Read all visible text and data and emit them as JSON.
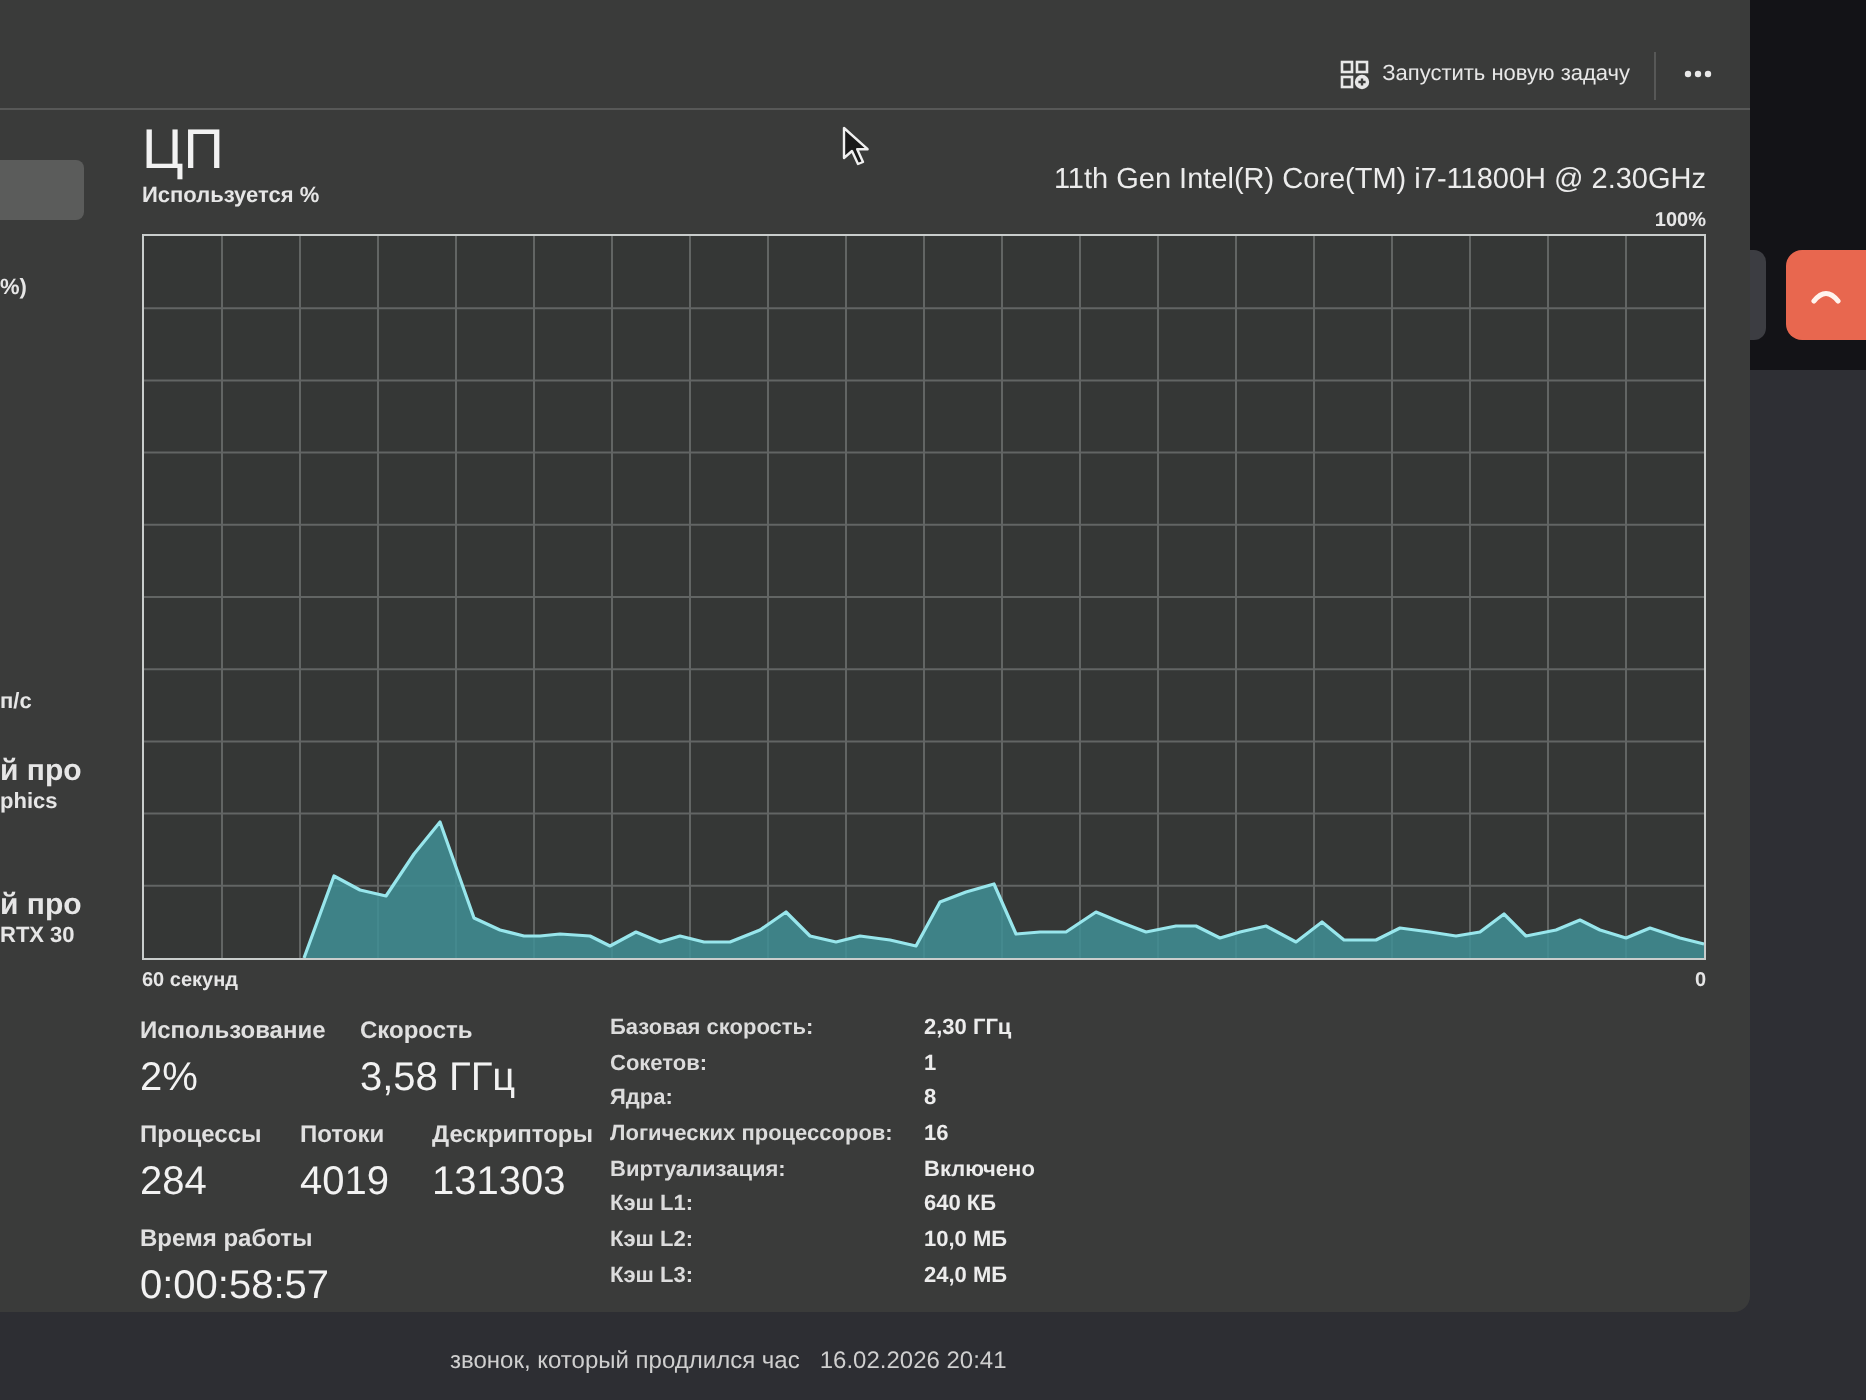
{
  "command_bar": {
    "new_task_button": "Запустить новую задачу"
  },
  "sidebar": {
    "items": [
      {
        "selected": true
      },
      {
        "lines": [
          "%)"
        ],
        "selected": false
      },
      {
        "lines": [
          "п/с"
        ],
        "selected": false
      },
      {
        "lines": [
          "й про",
          "phics"
        ],
        "selected": false
      },
      {
        "lines": [
          "й про",
          "RTX 30"
        ],
        "selected": false
      }
    ]
  },
  "panel": {
    "title": "ЦП",
    "processor": "11th Gen Intel(R) Core(TM) i7-11800H @ 2.30GHz",
    "graph_label": "Используется %",
    "graph_max": "100%",
    "time_start": "60 секунд",
    "time_end": "0"
  },
  "stat_rows": [
    {
      "items": [
        {
          "label": "Использование",
          "value": "2%"
        },
        {
          "label": "Скорость",
          "value": "3,58 ГГц"
        }
      ]
    },
    {
      "items": [
        {
          "label": "Процессы",
          "value": "284"
        },
        {
          "label": "Потоки",
          "value": "4019"
        },
        {
          "label": "Дескрипторы",
          "value": "131303"
        }
      ]
    },
    {
      "items": [
        {
          "label": "Время работы",
          "value": "0:00:58:57"
        }
      ]
    }
  ],
  "details": [
    {
      "label": "Базовая скорость:",
      "value": "2,30 ГГц"
    },
    {
      "label": "Сокетов:",
      "value": "1"
    },
    {
      "label": "Ядра:",
      "value": "8"
    },
    {
      "label": "Логических процессоров:",
      "value": "16"
    },
    {
      "label": "Виртуализация:",
      "value": "Включено"
    },
    {
      "label": "Кэш L1:",
      "value": "640 КБ"
    },
    {
      "label": "Кэш L2:",
      "value": "10,0 МБ"
    },
    {
      "label": "Кэш L3:",
      "value": "24,0 МБ"
    }
  ],
  "background": {
    "call_notice": "звонок, который продлился час",
    "call_time": "16.02.2026 20:41"
  }
}
